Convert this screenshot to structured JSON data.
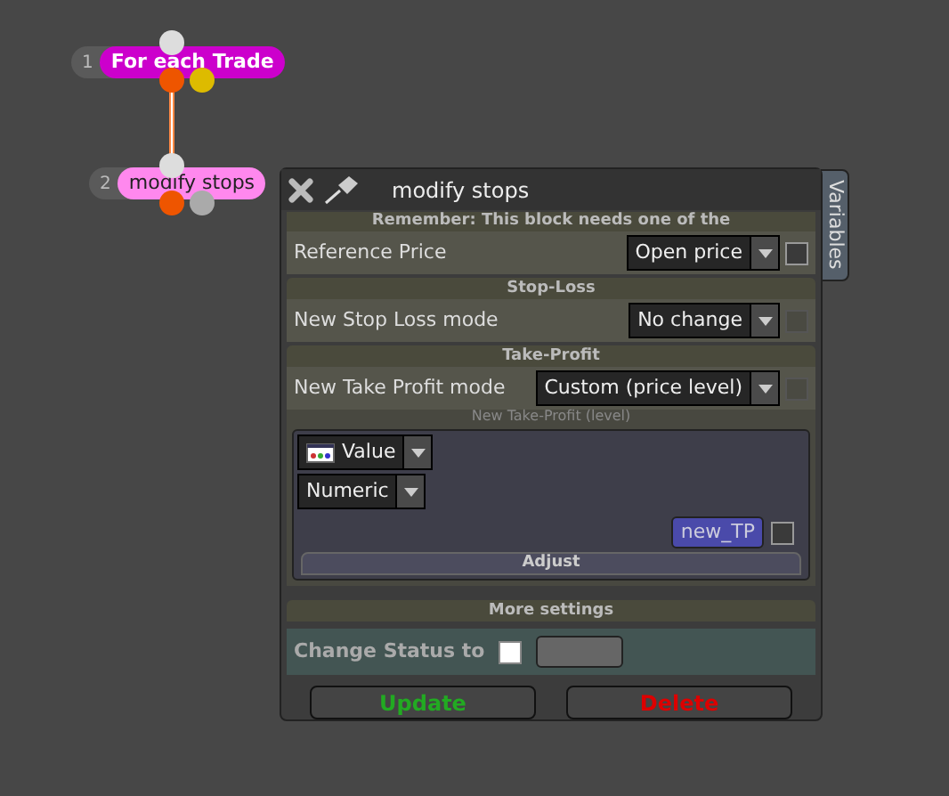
{
  "nodes": [
    {
      "number": "1",
      "label": "For each Trade",
      "color": "#cc00cc"
    },
    {
      "number": "2",
      "label": "modify stops",
      "color": "#ff88ee"
    }
  ],
  "panel": {
    "title": "modify stops",
    "side_tab": "Variables",
    "notice": "Remember: This block needs one of the",
    "reference_price": {
      "label": "Reference Price",
      "value": "Open price",
      "checked": false,
      "disabled": false
    },
    "stop_loss": {
      "heading": "Stop-Loss",
      "label": "New Stop Loss mode",
      "value": "No change",
      "checked": false,
      "disabled": true
    },
    "take_profit": {
      "heading": "Take-Profit",
      "label": "New Take Profit mode",
      "value": "Custom (price level)",
      "checked": false,
      "disabled": true,
      "level_label": "New Take-Profit (level)",
      "source": "Value",
      "type": "Numeric",
      "variable": "new_TP",
      "variable_checked": false,
      "adjust": "Adjust"
    },
    "more_settings": "More settings",
    "change_status": {
      "label": "Change Status to",
      "checked": false
    },
    "buttons": [
      {
        "label": "Update",
        "kind": "update"
      },
      {
        "label": "Delete",
        "kind": "delete"
      }
    ]
  }
}
